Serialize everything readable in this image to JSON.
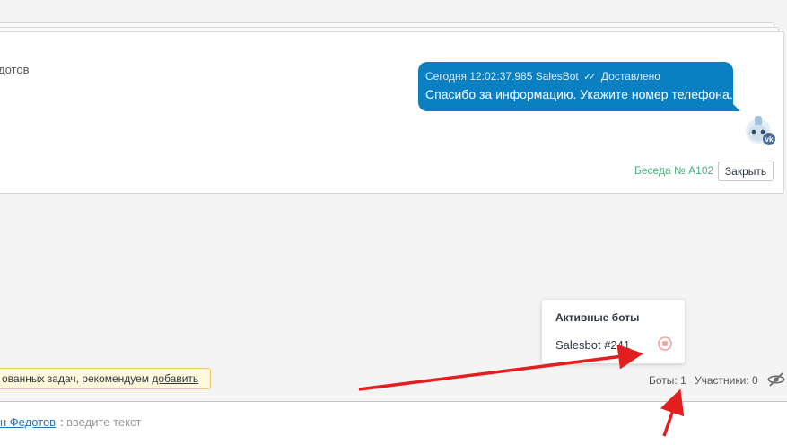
{
  "chat": {
    "partial_name": "дотов",
    "message": {
      "meta_time": "Сегодня 12:02:37.985 SalesBot",
      "status": "Доставлено",
      "text": "Спасибо за информацию. Укажите номер телефона."
    },
    "avatar_badge": "vk",
    "chat_number": "Беседа № А102",
    "close_label": "Закрыть"
  },
  "popup": {
    "title": "Активные боты",
    "bot_name": "Salesbot #241"
  },
  "hint": {
    "text": "ованных задач, рекомендуем ",
    "link": "добавить"
  },
  "status_bar": {
    "bots": "Боты: 1",
    "participants": "Участники: 0"
  },
  "input": {
    "user_name": "н Федотов",
    "separator": ":",
    "placeholder": "введите текст"
  },
  "colors": {
    "bubble": "#0a7fc1",
    "arrow": "#e31e1e",
    "stop": "#f2a0a0",
    "chat_number": "#4caf7d",
    "hint_bg": "#fff8dc"
  },
  "icons": [
    "double-check-icon",
    "bot-avatar-icon",
    "stop-icon",
    "eye-off-icon"
  ]
}
